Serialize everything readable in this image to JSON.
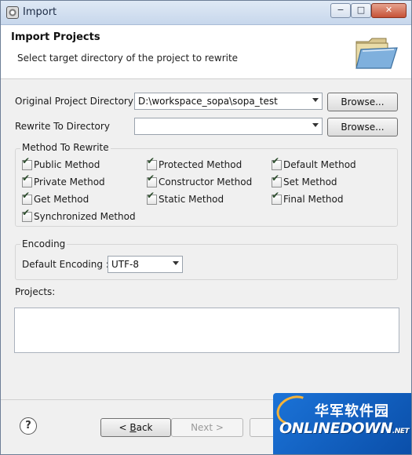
{
  "window": {
    "title": "Import",
    "min_glyph": "−",
    "max_glyph": "□",
    "close_glyph": "✕"
  },
  "header": {
    "title": "Import Projects",
    "description": "Select target directory of the project to rewrite",
    "icon": "folder-open-icon"
  },
  "form": {
    "original_label": "Original Project Directory",
    "original_value": "D:\\workspace_sopa\\sopa_test",
    "rewrite_label": "Rewrite To Directory",
    "rewrite_value": "",
    "browse_label": "Browse..."
  },
  "method_group": {
    "title": "Method To Rewrite",
    "options": [
      {
        "label": "Public Method",
        "checked": true
      },
      {
        "label": "Protected Method",
        "checked": true
      },
      {
        "label": "Default Method",
        "checked": true
      },
      {
        "label": "Private Method",
        "checked": true
      },
      {
        "label": "Constructor Method",
        "checked": true
      },
      {
        "label": "Set Method",
        "checked": true
      },
      {
        "label": "Get Method",
        "checked": true
      },
      {
        "label": "Static Method",
        "checked": true
      },
      {
        "label": "Final Method",
        "checked": true
      },
      {
        "label": "Synchronized Method",
        "checked": true
      }
    ]
  },
  "encoding_group": {
    "title": "Encoding",
    "label": "Default Encoding :",
    "value": "UTF-8"
  },
  "projects": {
    "label": "Projects:"
  },
  "footer": {
    "help_glyph": "?",
    "back_prefix": "< ",
    "back_key": "B",
    "back_rest": "ack",
    "next_label": "Next >"
  },
  "watermark": {
    "cn": "华军软件园",
    "en": "ONLINEDOWN",
    "en_suffix": ".NET",
    "check_glyph": "✔"
  }
}
